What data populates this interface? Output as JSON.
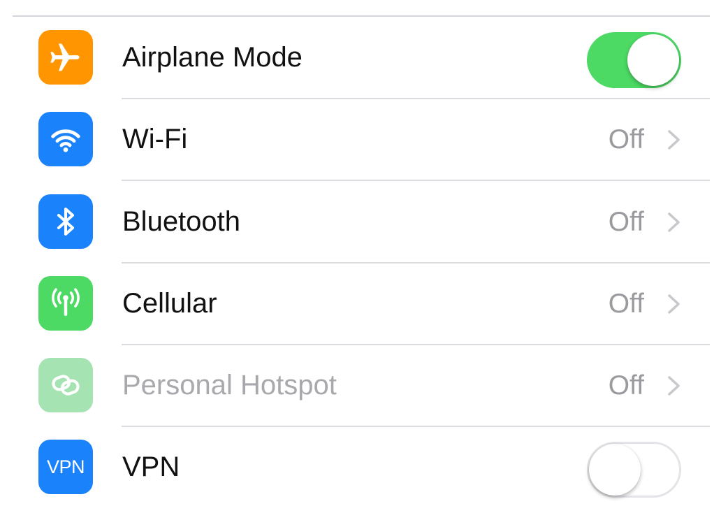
{
  "settings": {
    "rows": [
      {
        "label": "Airplane Mode",
        "icon": "airplane-icon",
        "icon_color": "#ff9500",
        "control": "toggle",
        "toggle_on": true
      },
      {
        "label": "Wi-Fi",
        "icon": "wifi-icon",
        "icon_color": "#1a82fb",
        "control": "value",
        "value": "Off"
      },
      {
        "label": "Bluetooth",
        "icon": "bluetooth-icon",
        "icon_color": "#1a82fb",
        "control": "value",
        "value": "Off"
      },
      {
        "label": "Cellular",
        "icon": "cellular-antenna-icon",
        "icon_color": "#4cd964",
        "control": "value",
        "value": "Off"
      },
      {
        "label": "Personal Hotspot",
        "icon": "hotspot-link-icon",
        "icon_color": "#a6e3b2",
        "control": "value",
        "value": "Off",
        "disabled": true
      },
      {
        "label": "VPN",
        "icon": "vpn-icon",
        "icon_text": "VPN",
        "icon_color": "#1a82fb",
        "control": "toggle",
        "toggle_on": false
      }
    ]
  },
  "colors": {
    "toggle_on": "#4cd964",
    "value_text": "#9a9a9f",
    "chevron": "#c7c7cc",
    "divider": "#dcdce0"
  }
}
